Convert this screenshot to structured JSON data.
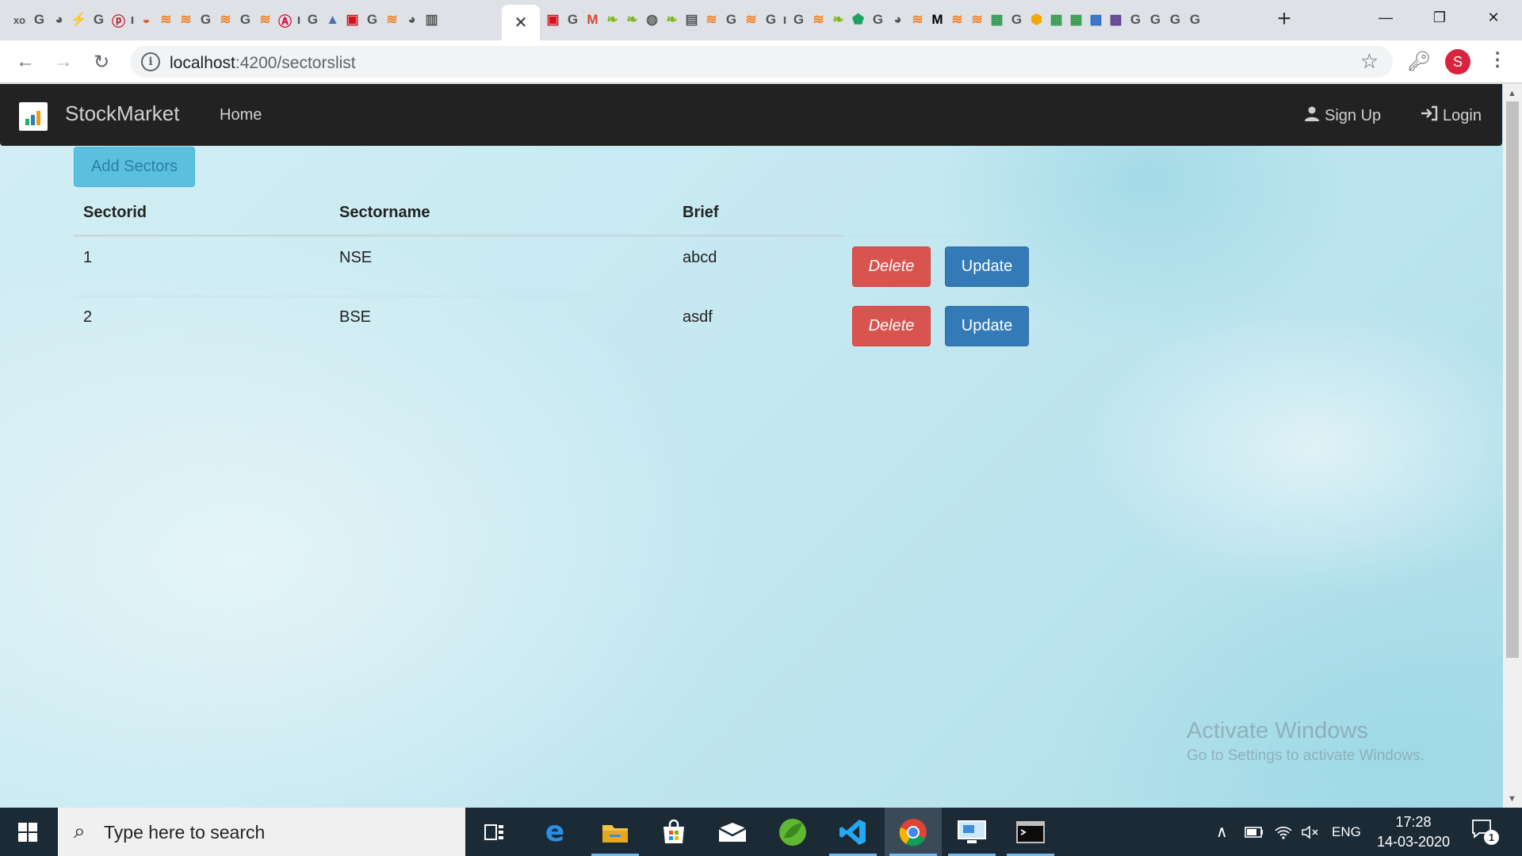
{
  "browser": {
    "url_host": "localhost",
    "url_path": ":4200/sectorslist",
    "profile_initial": "S",
    "tab_close": "✕",
    "new_tab": "+"
  },
  "app": {
    "brand": "StockMarket",
    "nav": {
      "home": "Home",
      "signup": "Sign Up",
      "login": "Login"
    },
    "add_button": "Add Sectors",
    "table": {
      "headers": [
        "Sectorid",
        "Sectorname",
        "Brief"
      ],
      "rows": [
        {
          "id": "1",
          "name": "NSE",
          "brief": "abcd",
          "delete": "Delete",
          "update": "Update"
        },
        {
          "id": "2",
          "name": "BSE",
          "brief": "asdf",
          "delete": "Delete",
          "update": "Update"
        }
      ]
    }
  },
  "watermark": {
    "title": "Activate Windows",
    "subtitle": "Go to Settings to activate Windows."
  },
  "taskbar": {
    "search_placeholder": "Type here to search",
    "language": "ENG",
    "time": "17:28",
    "date": "14-03-2020",
    "notification_count": "1"
  },
  "colors": {
    "navbar": "#222222",
    "add_button": "#5bc0de",
    "delete_button": "#d9534f",
    "update_button": "#337ab7"
  }
}
